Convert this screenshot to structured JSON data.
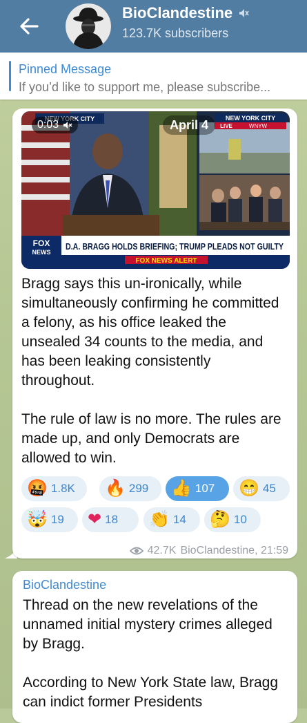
{
  "header": {
    "title": "BioClandestine",
    "subscribers": "123.7K subscribers",
    "colors": {
      "bar": "#527da3"
    },
    "icons": {
      "back": "back-arrow-icon",
      "mute": "muted-icon"
    }
  },
  "pinned": {
    "title": "Pinned Message",
    "text": "If you’d like to support me, please subscribe..."
  },
  "message1": {
    "video": {
      "duration": "0:03",
      "date": "April 4",
      "overlay_texts": {
        "left_location": "NEW YORK CITY",
        "right_location": "NEW YORK CITY",
        "right_live": "LIVE",
        "right_channel": "WNYW",
        "chyron": "D.A. BRAGG HOLDS BRIEFING; TRUMP PLEADS NOT GUILTY",
        "alert": "FOX NEWS ALERT",
        "logo_fox": "FOX",
        "logo_news": "NEWS"
      }
    },
    "text": "Bragg says this un-ironically, while simultaneously confirming he committed a felony, as his office leaked the unsealed 34 counts to the media, and has been leaking consistently throughout.\n\nThe rule of law is no more. The rules are made up, and only Democrats are allowed to win.",
    "reactions": [
      {
        "emoji": "🤬",
        "icon": "angry-face-icon",
        "count": "1.8K",
        "active": false
      },
      {
        "emoji": "🔥",
        "icon": "fire-icon",
        "count": "299",
        "active": false
      },
      {
        "emoji": "👍",
        "icon": "thumbs-up-icon",
        "count": "107",
        "active": true
      },
      {
        "emoji": "😁",
        "icon": "grin-icon",
        "count": "45",
        "active": false
      },
      {
        "emoji": "🤯",
        "icon": "exploding-head-icon",
        "count": "19",
        "active": false
      },
      {
        "emoji": "❤",
        "icon": "heart-icon",
        "count": "18",
        "active": false
      },
      {
        "emoji": "👏",
        "icon": "clapping-icon",
        "count": "14",
        "active": false
      },
      {
        "emoji": "🤔",
        "icon": "thinking-face-icon",
        "count": "10",
        "active": false
      }
    ],
    "views": "42.7K",
    "signature": "BioClandestine, 21:59"
  },
  "message2": {
    "author": "BioClandestine",
    "text": "Thread on the new revelations of the unnamed initial mystery crimes alleged by Bragg.\n\nAccording to New York State law, Bragg can indict former Presidents"
  }
}
